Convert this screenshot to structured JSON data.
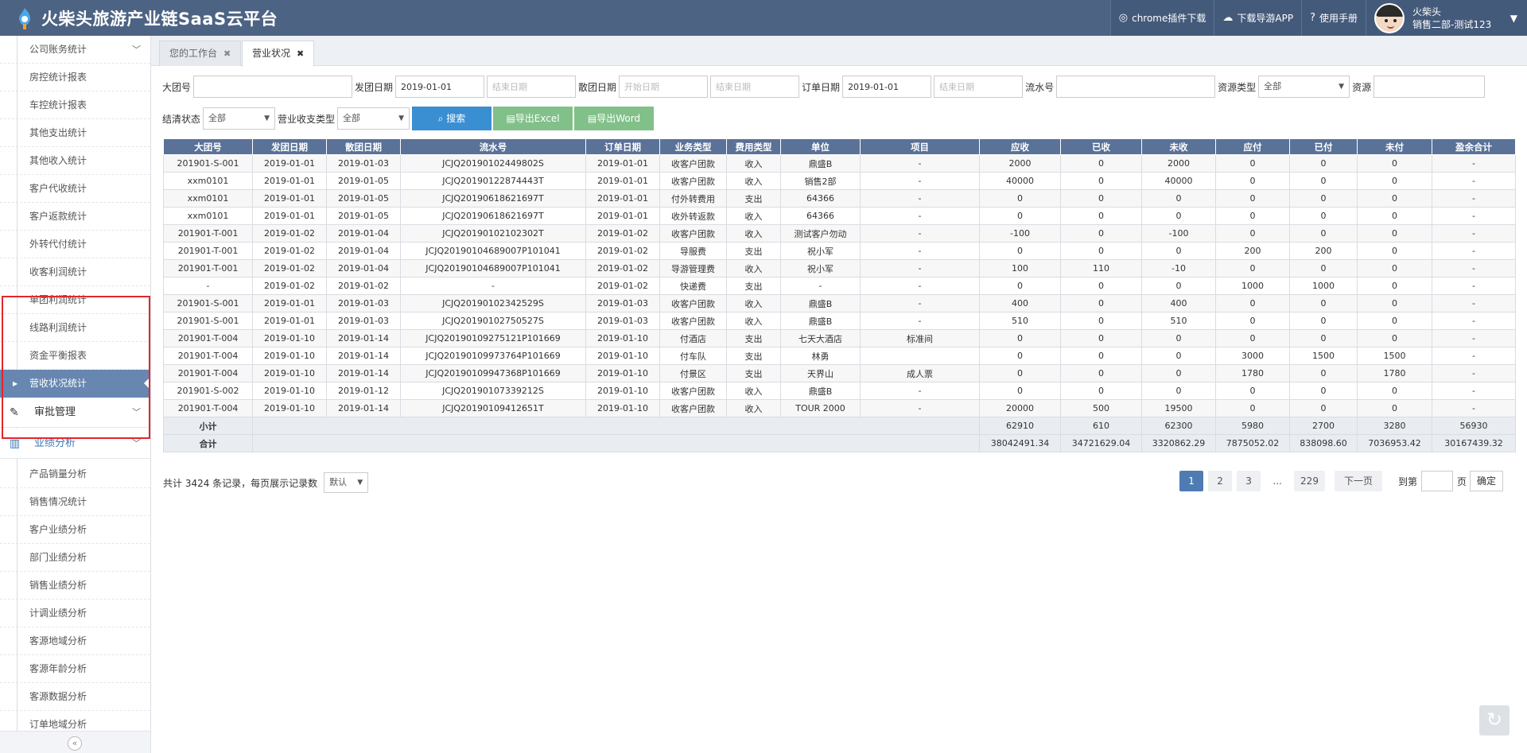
{
  "header": {
    "title": "火柴头旅游产业链SaaS云平台",
    "chrome_plugin": "chrome插件下载",
    "download_app": "下载导游APP",
    "manual": "使用手册",
    "user_name": "火柴头",
    "user_dept": "销售二部-测试123"
  },
  "sidebar": {
    "items": [
      {
        "label": "公司账务统计",
        "top": 0
      },
      {
        "label": "房控统计报表"
      },
      {
        "label": "车控统计报表"
      },
      {
        "label": "其他支出统计"
      },
      {
        "label": "其他收入统计"
      },
      {
        "label": "客户代收统计"
      },
      {
        "label": "客户返款统计"
      },
      {
        "label": "外转代付统计"
      },
      {
        "label": "收客利润统计"
      },
      {
        "label": "单团利润统计"
      },
      {
        "label": "线路利润统计"
      },
      {
        "label": "资金平衡报表"
      },
      {
        "label": "营收状况统计"
      }
    ],
    "group_approval": "审批管理",
    "group_performance": "业绩分析",
    "perf_items": [
      "产品销量分析",
      "销售情况统计",
      "客户业绩分析",
      "部门业绩分析",
      "销售业绩分析",
      "计调业绩分析",
      "客源地域分析",
      "客源年龄分析",
      "客源数据分析",
      "订单地域分析"
    ]
  },
  "tabs": [
    "您的工作台",
    "营业状况"
  ],
  "filters": {
    "group_no_label": "大团号",
    "dep_date_label": "发团日期",
    "dep_date_start": "2019-01-01",
    "dep_date_end_ph": "结束日期",
    "end_date_label": "散团日期",
    "end_date_start_ph": "开始日期",
    "end_date_end_ph": "结束日期",
    "order_date_label": "订单日期",
    "order_date_start": "2019-01-01",
    "order_date_end_ph": "结束日期",
    "serial_label": "流水号",
    "res_type_label": "资源类型",
    "res_type_value": "全部",
    "res_label": "资源",
    "settle_label": "结清状态",
    "settle_value": "全部",
    "income_type_label": "营业收支类型",
    "income_type_value": "全部",
    "search_btn": "搜索",
    "excel_btn": "导出Excel",
    "word_btn": "导出Word"
  },
  "table": {
    "columns": [
      "大团号",
      "发团日期",
      "散团日期",
      "流水号",
      "订单日期",
      "业务类型",
      "费用类型",
      "单位",
      "项目",
      "应收",
      "已收",
      "未收",
      "应付",
      "已付",
      "未付",
      "盈余合计"
    ],
    "rows": [
      [
        "201901-S-001",
        "2019-01-01",
        "2019-01-03",
        "JCJQ20190102449802S",
        "2019-01-01",
        "收客户团款",
        "收入",
        "鼎盛B",
        "-",
        "2000",
        "0",
        "2000",
        "0",
        "0",
        "0",
        "-"
      ],
      [
        "xxm0101",
        "2019-01-01",
        "2019-01-05",
        "JCJQ20190122874443T",
        "2019-01-01",
        "收客户团款",
        "收入",
        "销售2部",
        "-",
        "40000",
        "0",
        "40000",
        "0",
        "0",
        "0",
        "-"
      ],
      [
        "xxm0101",
        "2019-01-01",
        "2019-01-05",
        "JCJQ20190618621697T",
        "2019-01-01",
        "付外转费用",
        "支出",
        "64366",
        "-",
        "0",
        "0",
        "0",
        "0",
        "0",
        "0",
        "-"
      ],
      [
        "xxm0101",
        "2019-01-01",
        "2019-01-05",
        "JCJQ20190618621697T",
        "2019-01-01",
        "收外转返款",
        "收入",
        "64366",
        "-",
        "0",
        "0",
        "0",
        "0",
        "0",
        "0",
        "-"
      ],
      [
        "201901-T-001",
        "2019-01-02",
        "2019-01-04",
        "JCJQ20190102102302T",
        "2019-01-02",
        "收客户团款",
        "收入",
        "测试客户勿动",
        "-",
        "-100",
        "0",
        "-100",
        "0",
        "0",
        "0",
        "-"
      ],
      [
        "201901-T-001",
        "2019-01-02",
        "2019-01-04",
        "JCJQ20190104689007P101041",
        "2019-01-02",
        "导服费",
        "支出",
        "祝小军",
        "-",
        "0",
        "0",
        "0",
        "200",
        "200",
        "0",
        "-"
      ],
      [
        "201901-T-001",
        "2019-01-02",
        "2019-01-04",
        "JCJQ20190104689007P101041",
        "2019-01-02",
        "导游管理费",
        "收入",
        "祝小军",
        "-",
        "100",
        "110",
        "-10",
        "0",
        "0",
        "0",
        "-"
      ],
      [
        "-",
        "2019-01-02",
        "2019-01-02",
        "-",
        "2019-01-02",
        "快递费",
        "支出",
        "-",
        "-",
        "0",
        "0",
        "0",
        "1000",
        "1000",
        "0",
        "-"
      ],
      [
        "201901-S-001",
        "2019-01-01",
        "2019-01-03",
        "JCJQ20190102342529S",
        "2019-01-03",
        "收客户团款",
        "收入",
        "鼎盛B",
        "-",
        "400",
        "0",
        "400",
        "0",
        "0",
        "0",
        "-"
      ],
      [
        "201901-S-001",
        "2019-01-01",
        "2019-01-03",
        "JCJQ20190102750527S",
        "2019-01-03",
        "收客户团款",
        "收入",
        "鼎盛B",
        "-",
        "510",
        "0",
        "510",
        "0",
        "0",
        "0",
        "-"
      ],
      [
        "201901-T-004",
        "2019-01-10",
        "2019-01-14",
        "JCJQ20190109275121P101669",
        "2019-01-10",
        "付酒店",
        "支出",
        "七天大酒店",
        "标准间",
        "0",
        "0",
        "0",
        "0",
        "0",
        "0",
        "-"
      ],
      [
        "201901-T-004",
        "2019-01-10",
        "2019-01-14",
        "JCJQ20190109973764P101669",
        "2019-01-10",
        "付车队",
        "支出",
        "林勇",
        "",
        "0",
        "0",
        "0",
        "3000",
        "1500",
        "1500",
        "-"
      ],
      [
        "201901-T-004",
        "2019-01-10",
        "2019-01-14",
        "JCJQ20190109947368P101669",
        "2019-01-10",
        "付景区",
        "支出",
        "天界山",
        "成人票",
        "0",
        "0",
        "0",
        "1780",
        "0",
        "1780",
        "-"
      ],
      [
        "201901-S-002",
        "2019-01-10",
        "2019-01-12",
        "JCJQ20190107339212S",
        "2019-01-10",
        "收客户团款",
        "收入",
        "鼎盛B",
        "-",
        "0",
        "0",
        "0",
        "0",
        "0",
        "0",
        "-"
      ],
      [
        "201901-T-004",
        "2019-01-10",
        "2019-01-14",
        "JCJQ20190109412651T",
        "2019-01-10",
        "收客户团款",
        "收入",
        "TOUR 2000",
        "-",
        "20000",
        "500",
        "19500",
        "0",
        "0",
        "0",
        "-"
      ]
    ],
    "subtotal": {
      "label": "小计",
      "values": [
        "62910",
        "610",
        "62300",
        "5980",
        "2700",
        "3280",
        "56930"
      ]
    },
    "total": {
      "label": "合计",
      "values": [
        "38042491.34",
        "34721629.04",
        "3320862.29",
        "7875052.02",
        "838098.60",
        "7036953.42",
        "30167439.32"
      ]
    }
  },
  "pager": {
    "info_prefix": "共计 3424 条记录，每页展示记录数",
    "page_size": "默认",
    "pages": [
      "1",
      "2",
      "3",
      "...",
      "229"
    ],
    "next": "下一页",
    "goto_prefix": "到第",
    "goto_suffix": "页",
    "confirm": "确定"
  },
  "colors": {
    "header_bg": "#4d6384",
    "accent_blue": "#3a8ed2",
    "export_green": "#82c08a",
    "highlight_red": "#e2262b"
  }
}
